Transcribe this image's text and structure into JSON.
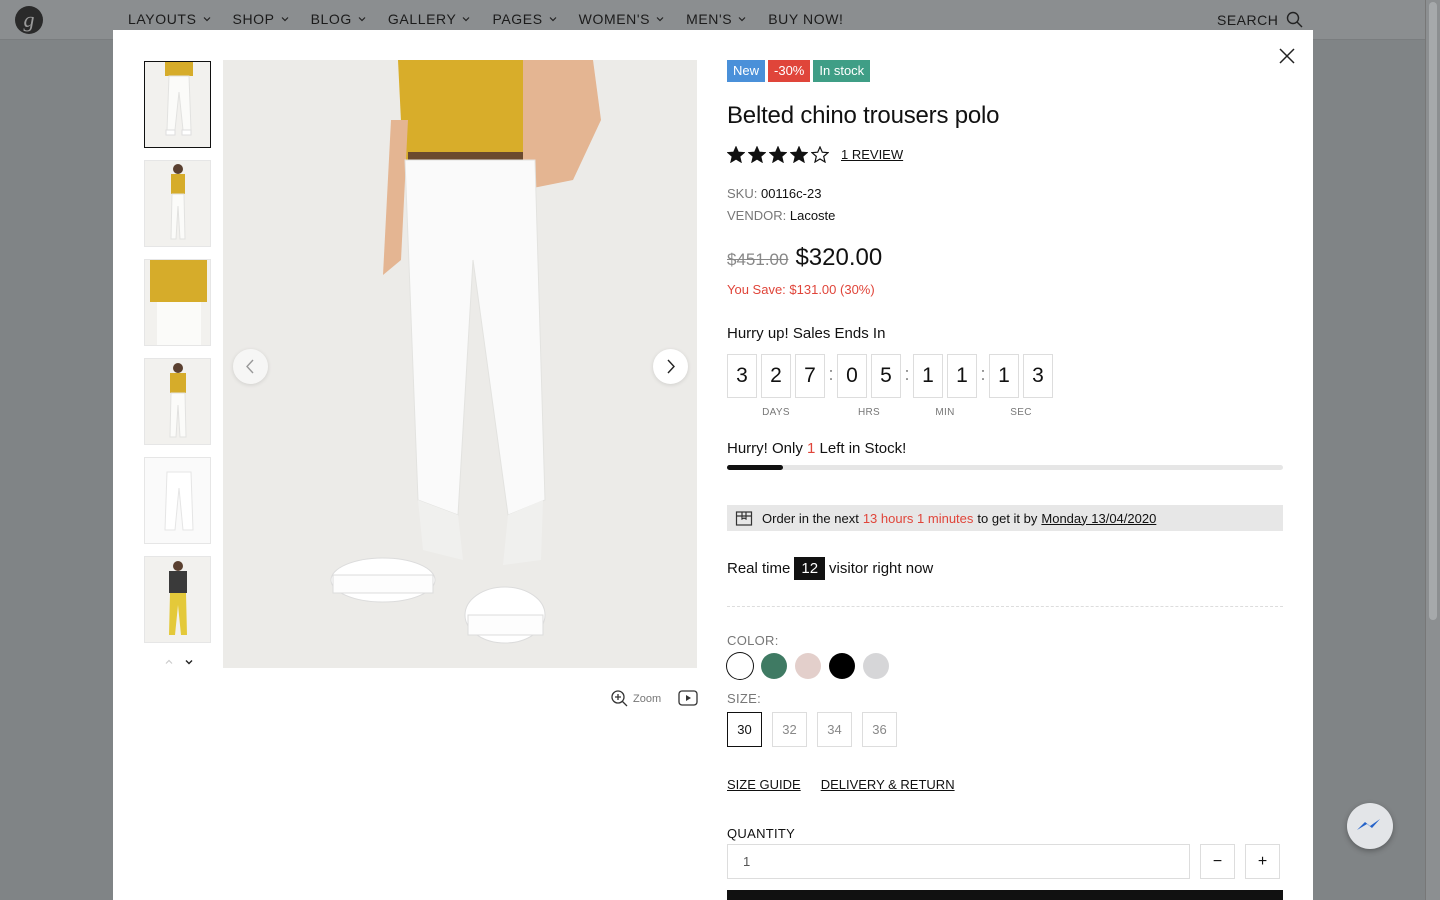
{
  "header": {
    "logo_letter": "g",
    "nav": [
      "LAYOUTS",
      "SHOP",
      "BLOG",
      "GALLERY",
      "PAGES",
      "WOMEN'S",
      "MEN'S",
      "BUY NOW!"
    ],
    "search_label": "SEARCH"
  },
  "gallery": {
    "zoom_label": "Zoom"
  },
  "product": {
    "badges": [
      {
        "text": "New",
        "color": "#4a90d9"
      },
      {
        "text": "-30%",
        "color": "#e0453a"
      },
      {
        "text": "In stock",
        "color": "#3f9e86"
      }
    ],
    "title": "Belted chino trousers polo",
    "rating": 4,
    "rating_max": 5,
    "review_text": "1 REVIEW",
    "sku_label": "SKU:",
    "sku": "00116c-23",
    "vendor_label": "VENDOR:",
    "vendor": "Lacoste",
    "old_price": "$451.00",
    "price": "$320.00",
    "save_text": "You Save: $131.00 (30%)"
  },
  "countdown": {
    "heading": "Hurry up! Sales Ends In",
    "units": [
      {
        "digits": [
          "3",
          "2",
          "7"
        ],
        "label": "DAYS"
      },
      {
        "digits": [
          "0",
          "5"
        ],
        "label": "HRS"
      },
      {
        "digits": [
          "1",
          "1"
        ],
        "label": "MIN"
      },
      {
        "digits": [
          "1",
          "3"
        ],
        "label": "SEC"
      }
    ],
    "separator": ":"
  },
  "stock": {
    "prefix": "Hurry! Only",
    "count": "1",
    "suffix": "Left in Stock!",
    "progress_percent": 10
  },
  "delivery": {
    "prefix": "Order in the next",
    "time": "13 hours 1 minutes",
    "middle": "to get it by",
    "date": "Monday 13/04/2020"
  },
  "visitors": {
    "prefix": "Real time",
    "count": "12",
    "suffix": "visitor right now"
  },
  "color": {
    "label": "COLOR:",
    "swatches": [
      "#ffffff",
      "#3f7a63",
      "#e3cfcb",
      "#000000",
      "#d6d6d8"
    ],
    "selected_index": 0
  },
  "size": {
    "label": "SIZE:",
    "options": [
      "30",
      "32",
      "34",
      "36"
    ],
    "selected": "30"
  },
  "links": {
    "size_guide": "SIZE GUIDE",
    "delivery_return": "DELIVERY & RETURN"
  },
  "quantity": {
    "label": "QUANTITY",
    "value": "1",
    "minus": "−",
    "plus": "+"
  }
}
